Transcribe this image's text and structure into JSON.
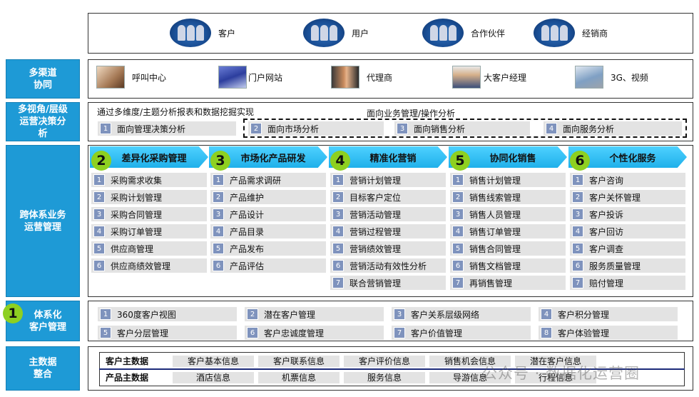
{
  "actors": [
    {
      "label": "客户",
      "icon": "people-icon"
    },
    {
      "label": "用户",
      "icon": "people-icon"
    },
    {
      "label": "合作伙伴",
      "icon": "people-icon"
    },
    {
      "label": "经销商",
      "icon": "people-icon"
    }
  ],
  "left_labels": {
    "multichannel": "多渠道\n协同",
    "multiview": "多视角/层级\n运营决策分\n析",
    "crossbiz": "跨体系业务\n运营管理",
    "crm": "体系化\n客户管理",
    "masterdata": "主数据\n整合"
  },
  "channels": [
    {
      "label": "呼叫中心",
      "icon": "call-center-photo-icon"
    },
    {
      "label": "门户网站",
      "icon": "portal-website-icon"
    },
    {
      "label": "代理商",
      "icon": "handshake-icon"
    },
    {
      "label": "大客户经理",
      "icon": "account-manager-icon"
    },
    {
      "label": "3G、视频",
      "icon": "laptop-icon"
    }
  ],
  "analysis": {
    "title": "通过多维度/主题分析报表和数据挖掘实现",
    "ops_title": "面向业务管理/操作分析",
    "items": [
      {
        "num": "1",
        "label": "面向管理决策分析"
      },
      {
        "num": "2",
        "label": "面向市场分析"
      },
      {
        "num": "3",
        "label": "面向销售分析"
      },
      {
        "num": "4",
        "label": "面向服务分析"
      }
    ]
  },
  "columns": [
    {
      "num": "2",
      "title": "差异化采购管理",
      "items": [
        "采购需求收集",
        "采购计划管理",
        "采购合同管理",
        "采购订单管理",
        "供应商管理",
        "供应商绩效管理"
      ]
    },
    {
      "num": "3",
      "title": "市场化产品研发",
      "items": [
        "产品需求调研",
        "产品维护",
        "产品设计",
        "产品目录",
        "产品发布",
        "产品评估"
      ]
    },
    {
      "num": "4",
      "title": "精准化营销",
      "items": [
        "营销计划管理",
        "目标客户定位",
        "营销活动管理",
        "营销过程管理",
        "营销绩效管理",
        "营销活动有效性分析",
        "联合营销管理"
      ]
    },
    {
      "num": "5",
      "title": "协同化销售",
      "items": [
        "销售计划管理",
        "销售线索管理",
        "销售人员管理",
        "销售订单管理",
        "销售合同管理",
        "销售文档管理",
        "再销售管理"
      ]
    },
    {
      "num": "6",
      "title": "个性化服务",
      "items": [
        "客户咨询",
        "客户关怀管理",
        "客户投诉",
        "客户回访",
        "客户调查",
        "服务质量管理",
        "赔付管理"
      ]
    }
  ],
  "crm": {
    "num": "1",
    "items": [
      "360度客户视图",
      "潜在客户管理",
      "客户关系层级网络",
      "客户积分管理",
      "客户分层管理",
      "客户忠诚度管理",
      "客户价值管理",
      "客户体验管理"
    ]
  },
  "master_data": {
    "rows": [
      {
        "key": "客户主数据",
        "values": [
          "客户基本信息",
          "客户联系信息",
          "客户评价信息",
          "销售机会信息",
          "潜在客户信息"
        ]
      },
      {
        "key": "产品主数据",
        "values": [
          "酒店信息",
          "机票信息",
          "服务信息",
          "导游信息",
          "行程信息"
        ]
      }
    ]
  },
  "watermark": "公众号 · 数据化运营圈",
  "colors": {
    "left_label_bg": "#1e9ad6",
    "header_arrow": "#2bbcf0",
    "step_circle": "#8ed021",
    "item_bg": "#e3e3e3",
    "num_badge": "#7f93bd"
  }
}
